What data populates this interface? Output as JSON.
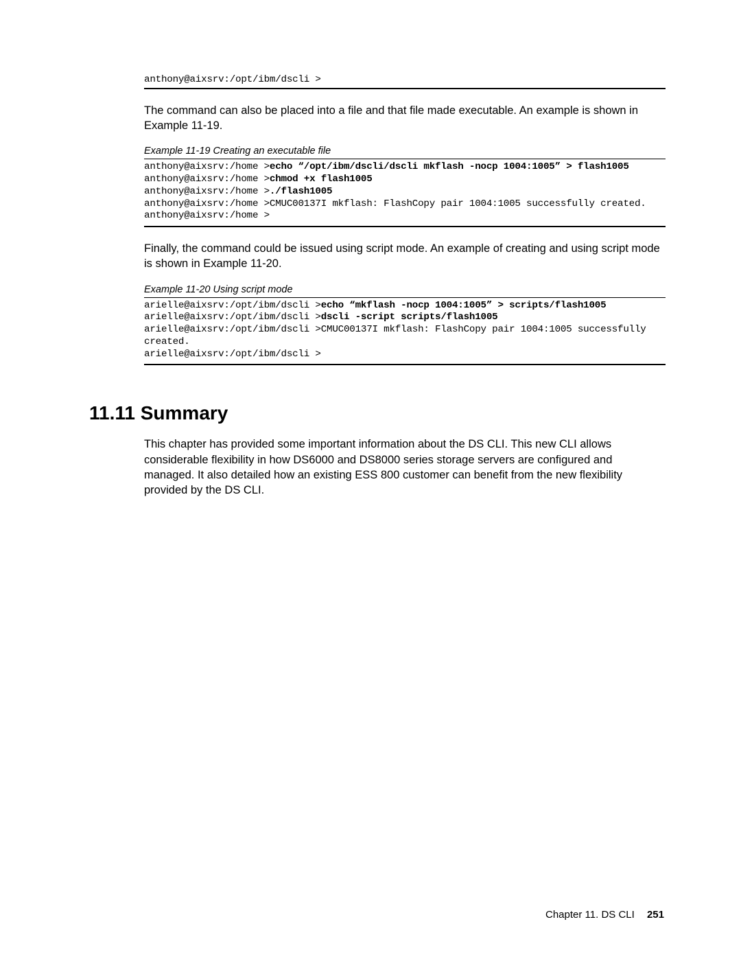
{
  "codeblock0": {
    "line1": "anthony@aixsrv:/opt/ibm/dscli >"
  },
  "para1": "The command can also be placed into a file and that file made executable. An example is shown in Example 11-19.",
  "example19": {
    "caption": "Example 11-19   Creating an executable file",
    "l1_prefix": "anthony@aixsrv:/home >",
    "l1_bold": "echo “/opt/ibm/dscli/dscli mkflash -nocp 1004:1005” > flash1005",
    "l2_prefix": "anthony@aixsrv:/home >",
    "l2_bold": "chmod +x flash1005",
    "l3_prefix": "anthony@aixsrv:/home >",
    "l3_bold": "./flash1005",
    "l4": "anthony@aixsrv:/home >CMUC00137I mkflash: FlashCopy pair 1004:1005 successfully created.",
    "l5": "anthony@aixsrv:/home >"
  },
  "para2": "Finally, the command could be issued using script mode. An example of creating and using script mode is shown in Example 11-20.",
  "example20": {
    "caption": "Example 11-20   Using script mode",
    "l1_prefix": "arielle@aixsrv:/opt/ibm/dscli >",
    "l1_bold": "echo “mkflash -nocp 1004:1005” > scripts/flash1005",
    "l2_prefix": "arielle@aixsrv:/opt/ibm/dscli >",
    "l2_bold": "dscli -script scripts/flash1005",
    "l3": "arielle@aixsrv:/opt/ibm/dscli >CMUC00137I mkflash: FlashCopy pair 1004:1005 successfully ",
    "l4": "created.",
    "l5": "arielle@aixsrv:/opt/ibm/dscli >"
  },
  "heading": "11.11  Summary",
  "summary": "This chapter has provided some important information about the DS CLI. This new CLI allows considerable flexibility in how DS6000 and DS8000 series storage servers are configured and managed. It also detailed how an existing ESS 800 customer can benefit from the new flexibility provided by the DS CLI.",
  "footer_chapter": " Chapter 11. DS CLI",
  "footer_page": "251"
}
